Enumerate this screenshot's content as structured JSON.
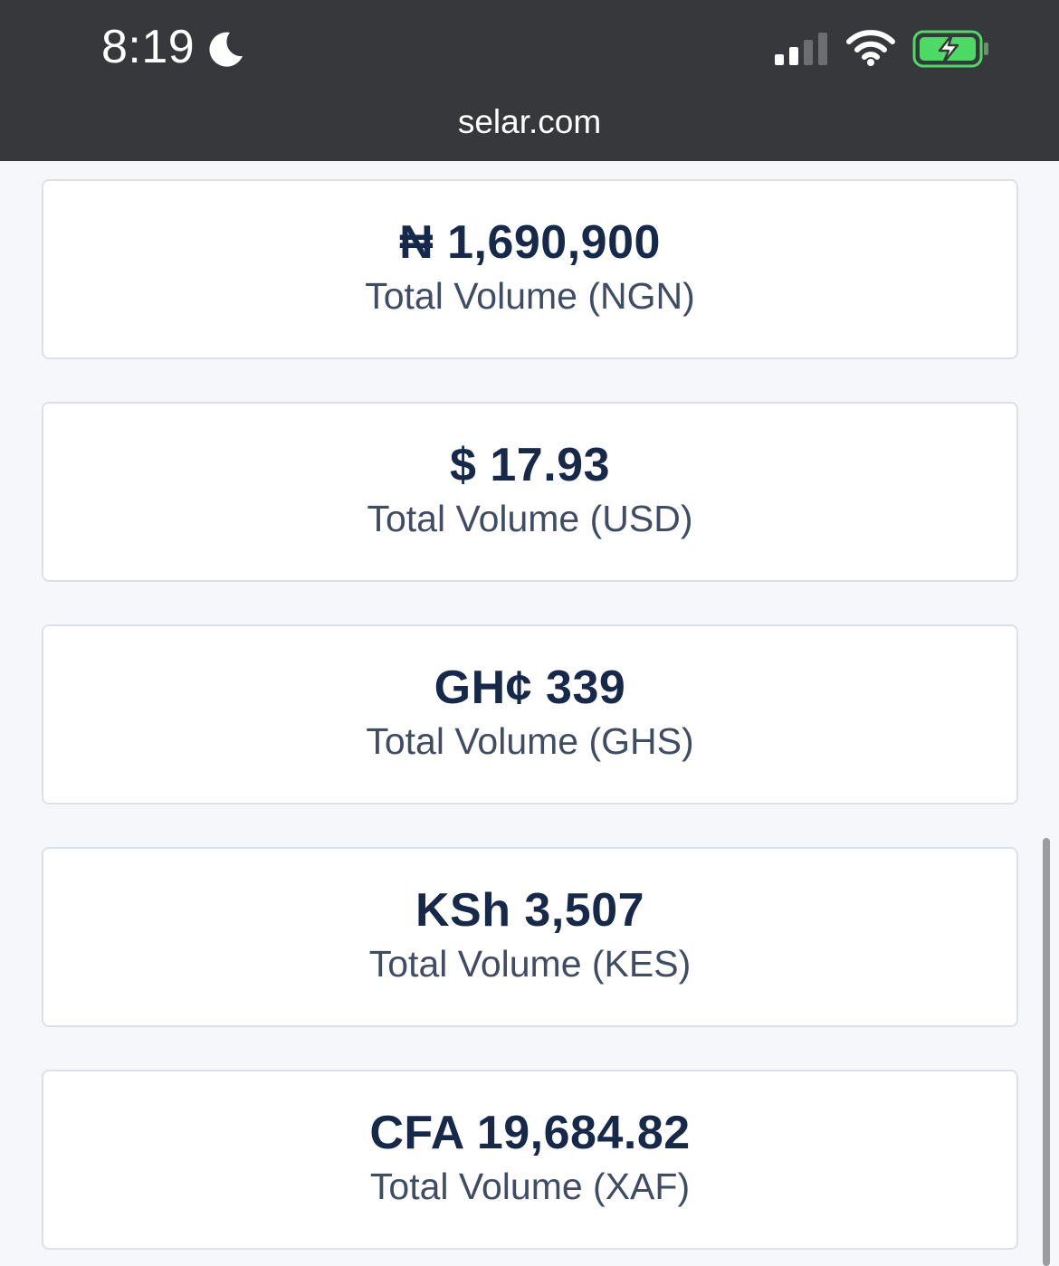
{
  "status_bar": {
    "time": "8:19",
    "icons": [
      "moon-icon",
      "cellular-signal-icon",
      "wifi-icon",
      "battery-charging-icon"
    ],
    "battery_color": "#4cd964"
  },
  "browser": {
    "url": "selar.com"
  },
  "cards": [
    {
      "amount": "₦ 1,690,900",
      "label": "Total Volume (NGN)"
    },
    {
      "amount": "$ 17.93",
      "label": "Total Volume (USD)"
    },
    {
      "amount": "GH¢ 339",
      "label": "Total Volume (GHS)"
    },
    {
      "amount": "KSh 3,507",
      "label": "Total Volume (KES)"
    },
    {
      "amount": "CFA 19,684.82",
      "label": "Total Volume (XAF)"
    }
  ],
  "colors": {
    "topbar": "#37383b",
    "page_background": "#f5f7fb",
    "amount_text": "#17294a",
    "label_text": "#3f4c63"
  }
}
